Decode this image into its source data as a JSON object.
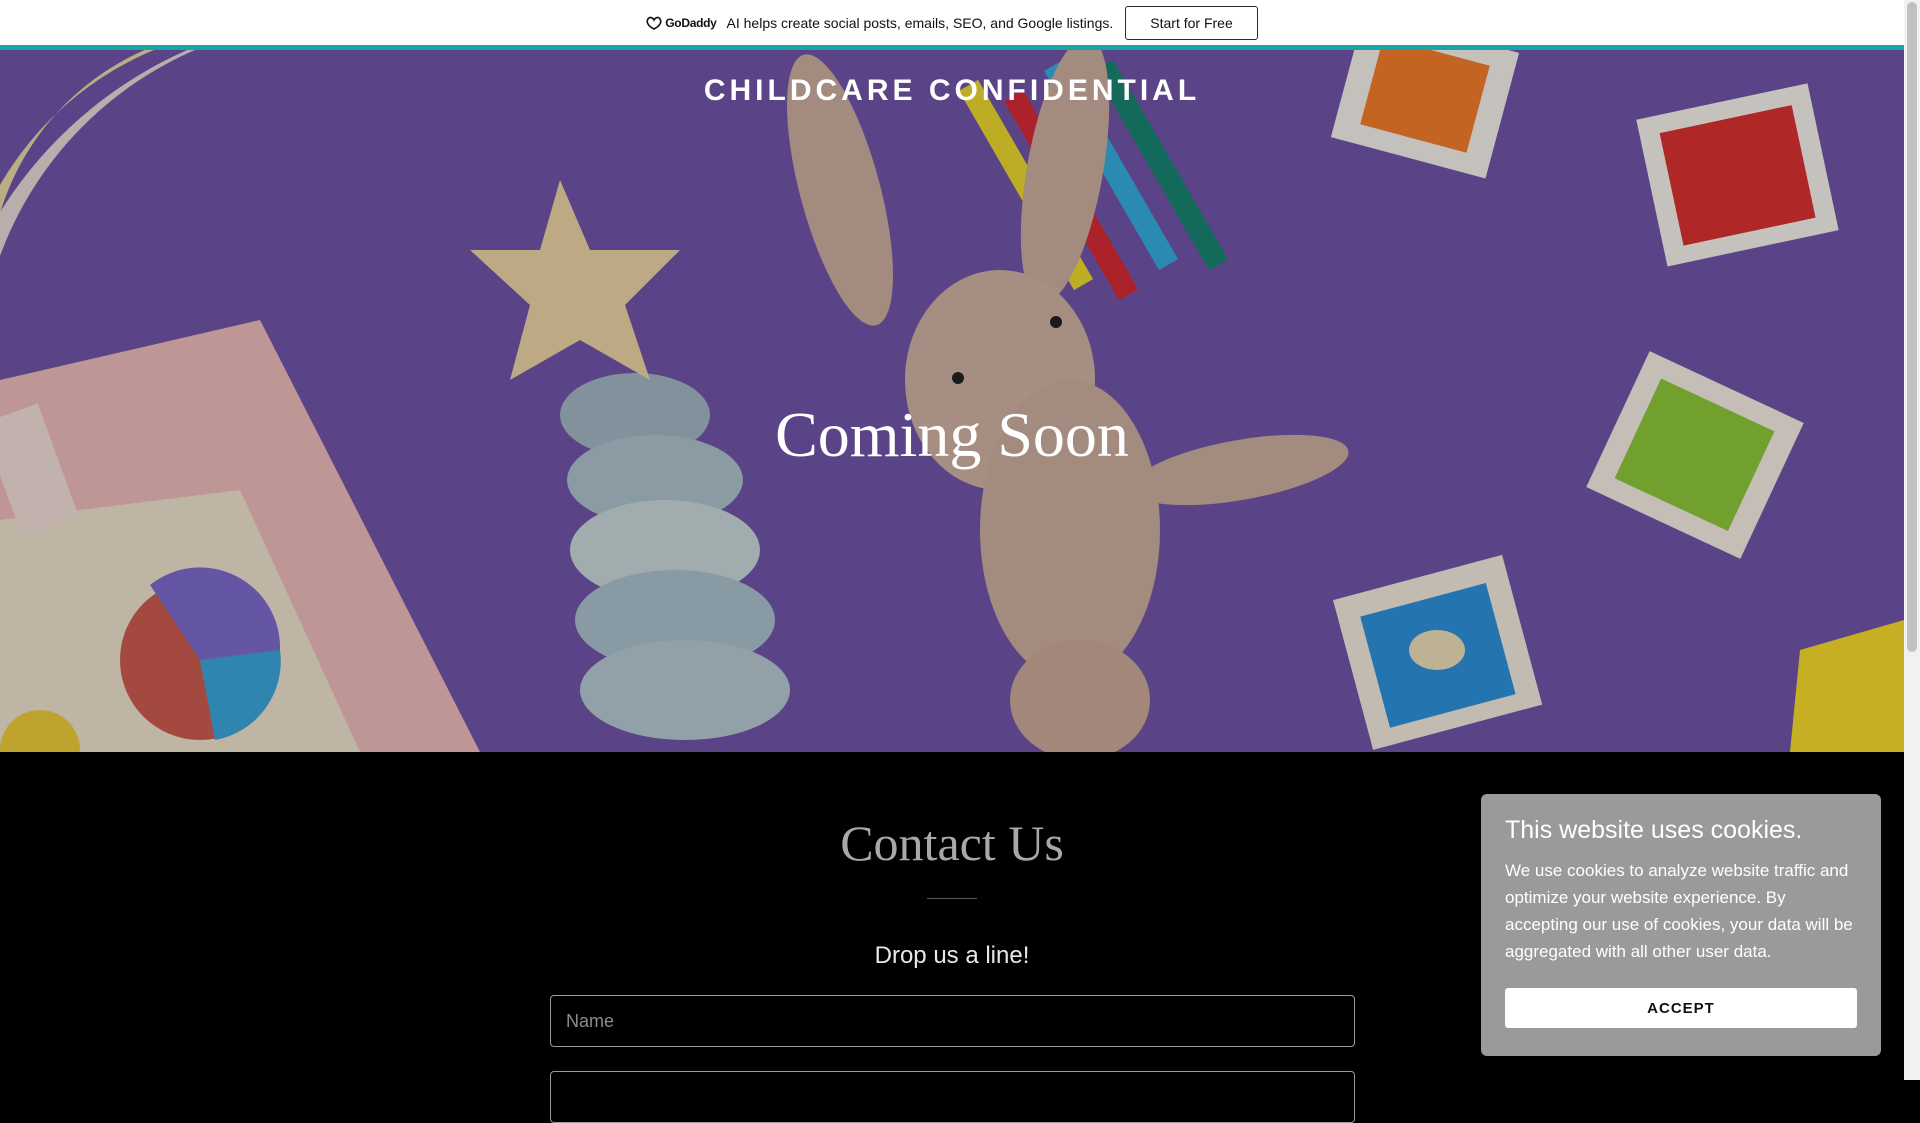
{
  "promo": {
    "logo_text": "GoDaddy",
    "message": "AI helps create social posts, emails, SEO, and Google listings.",
    "cta_label": "Start for Free"
  },
  "hero": {
    "site_title": "CHILDCARE CONFIDENTIAL",
    "heading": "Coming Soon"
  },
  "contact": {
    "title": "Contact Us",
    "subtitle": "Drop us a line!",
    "name_placeholder": "Name",
    "email_placeholder": ""
  },
  "cookie": {
    "title": "This website uses cookies.",
    "body": "We use cookies to analyze website traffic and optimize your website experience. By accepting our use of cookies, your data will be aggregated with all other user data.",
    "accept_label": "ACCEPT"
  },
  "colors": {
    "accent_bar": "#1ba3a8",
    "hero_background": "#6f55a6",
    "page_background": "#000000"
  },
  "icons": [
    "godaddy-logo-icon"
  ]
}
